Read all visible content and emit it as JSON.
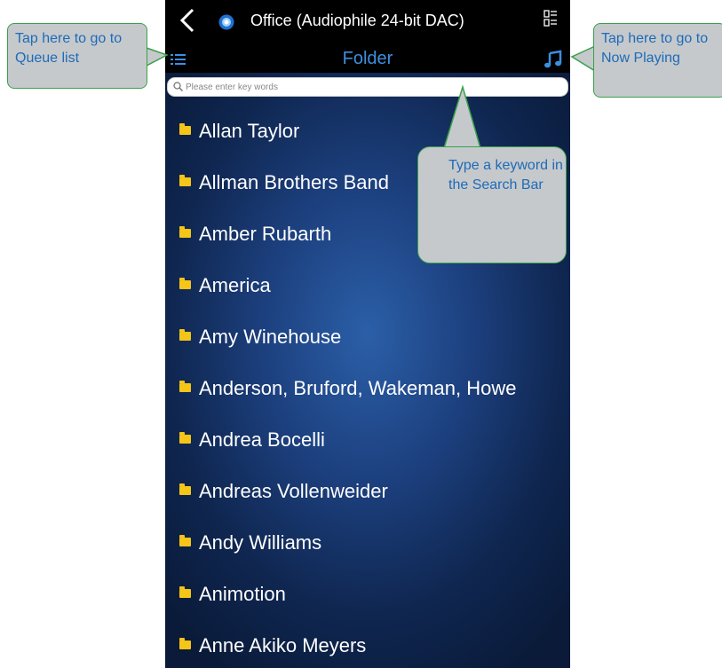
{
  "header": {
    "back_label": "<",
    "device_title": "Office (Audiophile 24-bit DAC)",
    "icons": [
      "back-arrow-icon",
      "device-icon",
      "layout-grid-icon"
    ]
  },
  "subheader": {
    "title": "Folder",
    "icons": [
      "queue-list-icon",
      "music-note-icon"
    ]
  },
  "search": {
    "placeholder": "Please enter key words",
    "value": ""
  },
  "folders": [
    {
      "label": "Allan Taylor"
    },
    {
      "label": "Allman Brothers Band"
    },
    {
      "label": "Amber Rubarth"
    },
    {
      "label": "America"
    },
    {
      "label": "Amy Winehouse"
    },
    {
      "label": "Anderson, Bruford, Wakeman, Howe"
    },
    {
      "label": "Andrea Bocelli"
    },
    {
      "label": "Andreas Vollenweider"
    },
    {
      "label": "Andy Williams"
    },
    {
      "label": "Animotion"
    },
    {
      "label": "Anne Akiko Meyers"
    }
  ],
  "callouts": {
    "queue": "Tap here to go to Queue list",
    "now_playing": "Tap here to go to Now Playing",
    "search": "Type a keyword in the Search Bar"
  },
  "colors": {
    "accent": "#3d8fe0",
    "folder_icon": "#f5c518",
    "callout_bg": "#c5c9cc",
    "callout_border": "#3aa04a",
    "callout_text": "#1e6bb8"
  }
}
